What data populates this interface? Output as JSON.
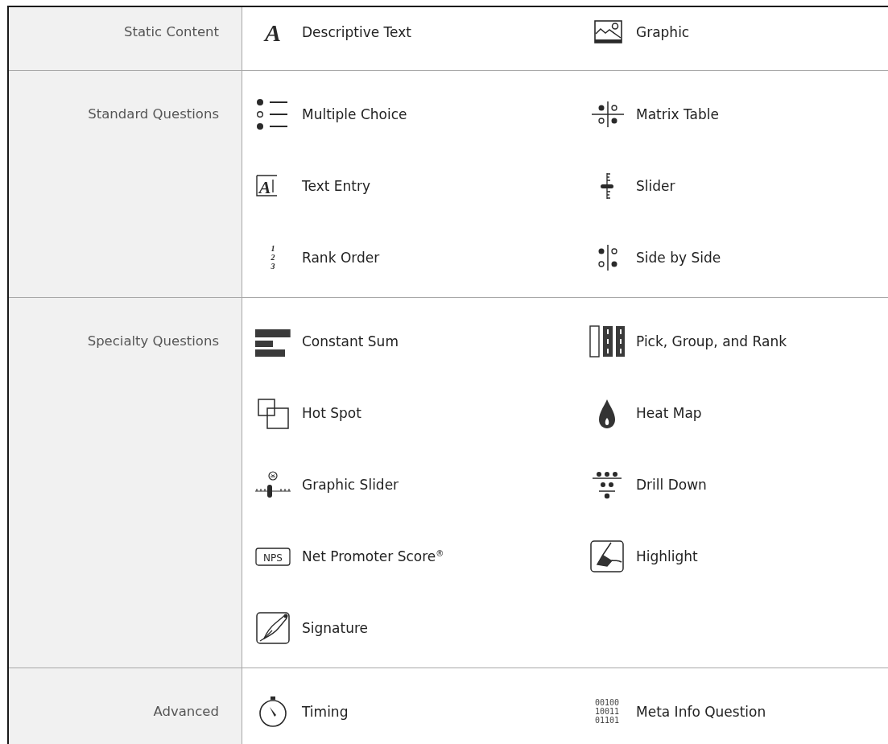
{
  "sections": [
    {
      "label": "Static Content",
      "items": [
        {
          "label": "Descriptive Text",
          "kind": "serif-letter",
          "icon_text": [
            "A"
          ]
        },
        {
          "label": "Graphic",
          "kind": "image"
        }
      ]
    },
    {
      "label": "Standard Questions",
      "items": [
        {
          "label": "Multiple Choice",
          "kind": "choice-list"
        },
        {
          "label": "Matrix Table",
          "kind": "matrix"
        },
        {
          "label": "Text Entry",
          "kind": "boxed-letter",
          "icon_text": [
            "A"
          ]
        },
        {
          "label": "Slider",
          "kind": "slider"
        },
        {
          "label": "Rank Order",
          "kind": "numbers",
          "icon_text": [
            "1",
            "2",
            "3"
          ]
        },
        {
          "label": "Side by Side",
          "kind": "side-by-side"
        }
      ]
    },
    {
      "label": "Specialty Questions",
      "items": [
        {
          "label": "Constant Sum",
          "kind": "bars"
        },
        {
          "label": "Pick, Group, and Rank",
          "kind": "columns"
        },
        {
          "label": "Hot Spot",
          "kind": "squares"
        },
        {
          "label": "Heat Map",
          "kind": "flame"
        },
        {
          "label": "Graphic Slider",
          "kind": "graphic-slider"
        },
        {
          "label": "Drill Down",
          "kind": "tiers"
        },
        {
          "label": "Net Promoter Score$^{®}$",
          "kind": "badge",
          "icon_text": [
            "NPS"
          ]
        },
        {
          "label": "Highlight",
          "kind": "highlight"
        },
        {
          "label": "Signature",
          "kind": "pen"
        }
      ]
    },
    {
      "label": "Advanced",
      "items": [
        {
          "label": "Timing",
          "kind": "stopwatch"
        },
        {
          "label": "Meta Info Question",
          "kind": "binary",
          "icon_text": [
            "00100",
            "10011",
            "01101"
          ]
        }
      ]
    }
  ]
}
